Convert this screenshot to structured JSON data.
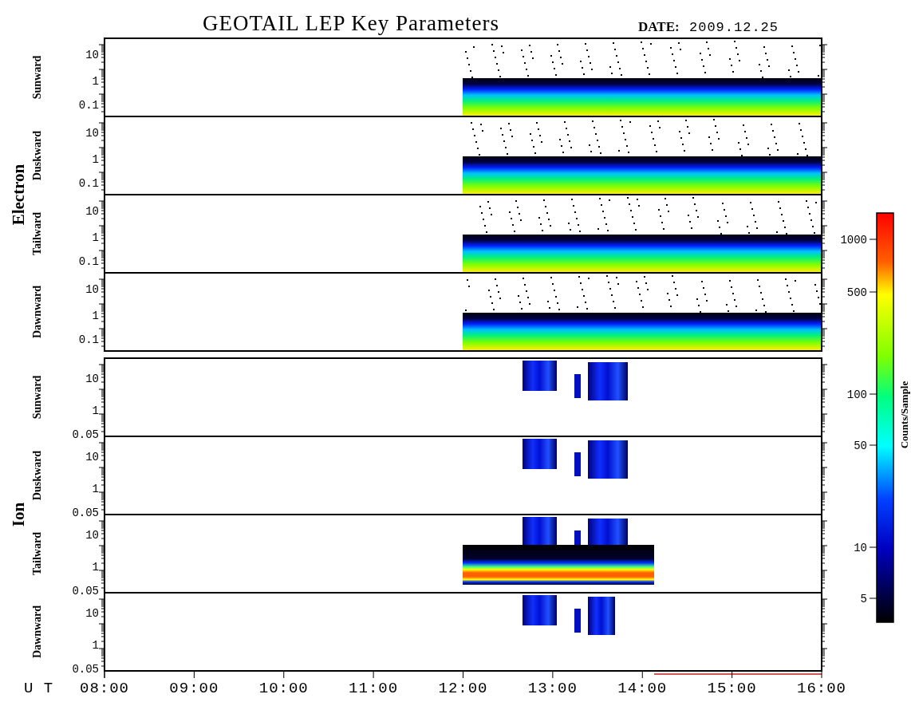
{
  "title": "GEOTAIL LEP Key Parameters",
  "date_label": "DATE:",
  "date": "2009.12.25",
  "groups": [
    {
      "name": "Electron",
      "kind": "electron",
      "panels": [
        {
          "label": "Sunward",
          "yticks": [
            "10",
            "1",
            "0.1"
          ]
        },
        {
          "label": "Duskward",
          "yticks": [
            "10",
            "1",
            "0.1"
          ]
        },
        {
          "label": "Tailward",
          "yticks": [
            "10",
            "1",
            "0.1"
          ]
        },
        {
          "label": "Dawnward",
          "yticks": [
            "10",
            "1",
            "0.1"
          ]
        }
      ]
    },
    {
      "name": "Ion",
      "kind": "ion",
      "panels": [
        {
          "label": "Sunward",
          "yticks": [
            "10",
            "1",
            "0.05"
          ]
        },
        {
          "label": "Duskward",
          "yticks": [
            "10",
            "1",
            "0.05"
          ]
        },
        {
          "label": "Tailward",
          "yticks": [
            "10",
            "1",
            "0.05"
          ]
        },
        {
          "label": "Dawnward",
          "yticks": [
            "10",
            "1",
            "0.05"
          ]
        }
      ]
    }
  ],
  "xaxis": {
    "label": "U T",
    "ticks": [
      "08:00",
      "09:00",
      "10:00",
      "11:00",
      "12:00",
      "13:00",
      "14:00",
      "15:00",
      "16:00"
    ]
  },
  "colorbar": {
    "label": "Counts/Sample",
    "ticks": [
      "1000",
      "500",
      "100",
      "50",
      "10",
      "5"
    ]
  }
}
